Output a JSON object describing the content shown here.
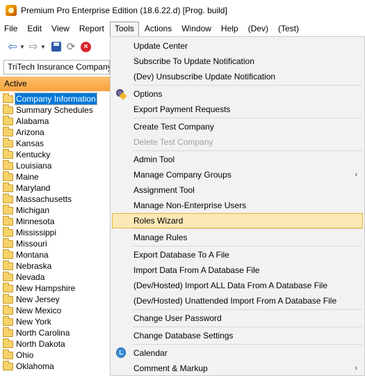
{
  "window": {
    "title": "Premium Pro Enterprise Edition  (18.6.22.d) [Prog. build]"
  },
  "menubar": {
    "items": [
      "File",
      "Edit",
      "View",
      "Report",
      "Tools",
      "Actions",
      "Window",
      "Help",
      "(Dev)",
      "(Test)"
    ],
    "active": "Tools"
  },
  "toolbar": {
    "icons": [
      "back-arrow-icon",
      "dropdown-arrow-icon",
      "forward-arrow-icon",
      "save-icon",
      "refresh-icon",
      "stop-icon"
    ]
  },
  "company_selector": {
    "value": "TriTech Insurance Company"
  },
  "sidebar": {
    "header": "Active",
    "accent_color": "#f7a23f",
    "selected_color": "#0078d7",
    "items": [
      "Company Information",
      "Summary Schedules",
      "Alabama",
      "Arizona",
      "Kansas",
      "Kentucky",
      "Louisiana",
      "Maine",
      "Maryland",
      "Massachusetts",
      "Michigan",
      "Minnesota",
      "Mississippi",
      "Missouri",
      "Montana",
      "Nebraska",
      "Nevada",
      "New Hampshire",
      "New Jersey",
      "New Mexico",
      "New York",
      "North Carolina",
      "North Dakota",
      "Ohio",
      "Oklahoma"
    ],
    "selected": "Company Information"
  },
  "tools_menu": {
    "highlight_color": "#fbe8b5",
    "items": [
      {
        "label": "Update Center"
      },
      {
        "label": "Subscribe To Update Notification"
      },
      {
        "label": "(Dev) Unsubscribe Update Notification"
      },
      {
        "label": "Options",
        "icon": "options-icon"
      },
      {
        "label": "Export Payment Requests"
      },
      {
        "label": "Create Test Company"
      },
      {
        "label": "Delete Test Company",
        "disabled": true
      },
      {
        "label": "Admin Tool"
      },
      {
        "label": "Manage Company Groups",
        "submenu": true
      },
      {
        "label": "Assignment Tool"
      },
      {
        "label": "Manage Non-Enterprise Users"
      },
      {
        "label": "Roles Wizard",
        "highlighted": true
      },
      {
        "label": "Manage Rules"
      },
      {
        "label": "Export Database To A File"
      },
      {
        "label": "Import Data From A Database File"
      },
      {
        "label": "(Dev/Hosted) Import ALL Data From A Database File"
      },
      {
        "label": "(Dev/Hosted) Unattended Import From A Database File"
      },
      {
        "label": "Change User Password"
      },
      {
        "label": "Change Database Settings"
      },
      {
        "label": "Calendar",
        "icon": "calendar-icon"
      },
      {
        "label": "Comment & Markup",
        "submenu": true
      }
    ],
    "submenu_glyph": "›"
  }
}
